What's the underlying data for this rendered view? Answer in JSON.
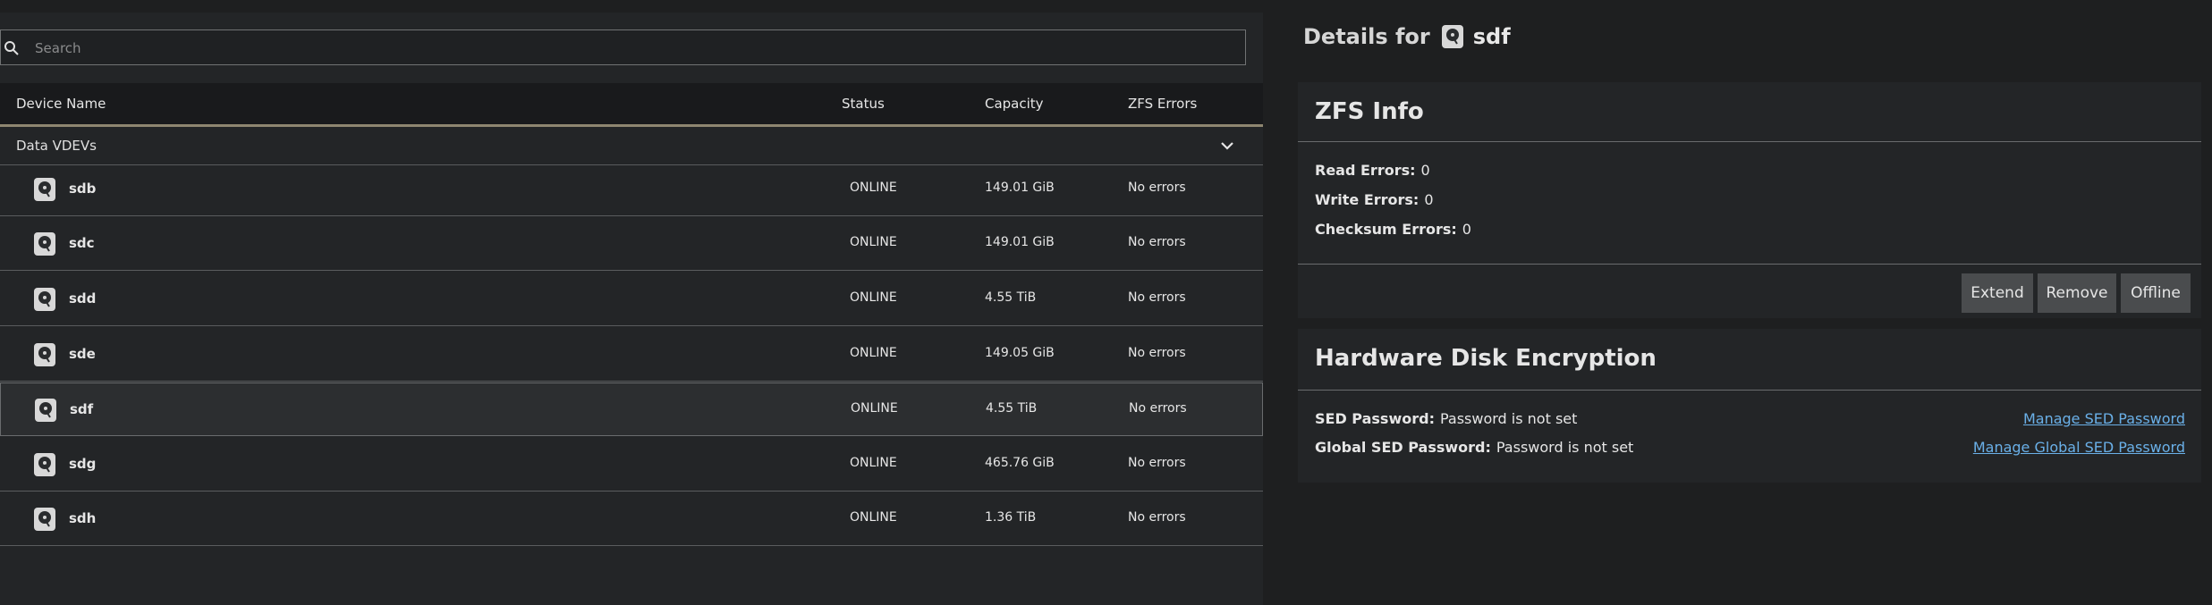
{
  "search": {
    "placeholder": "Search",
    "value": ""
  },
  "table": {
    "headers": {
      "device_name": "Device Name",
      "status": "Status",
      "capacity": "Capacity",
      "zfs_errors": "ZFS Errors"
    },
    "group": "Data VDEVs",
    "rows": [
      {
        "name": "sdb",
        "status": "ONLINE",
        "capacity": "149.01 GiB",
        "errors": "No errors"
      },
      {
        "name": "sdc",
        "status": "ONLINE",
        "capacity": "149.01 GiB",
        "errors": "No errors"
      },
      {
        "name": "sdd",
        "status": "ONLINE",
        "capacity": "4.55 TiB",
        "errors": "No errors"
      },
      {
        "name": "sde",
        "status": "ONLINE",
        "capacity": "149.05 GiB",
        "errors": "No errors"
      },
      {
        "name": "sdf",
        "status": "ONLINE",
        "capacity": "4.55 TiB",
        "errors": "No errors"
      },
      {
        "name": "sdg",
        "status": "ONLINE",
        "capacity": "465.76 GiB",
        "errors": "No errors"
      },
      {
        "name": "sdh",
        "status": "ONLINE",
        "capacity": "1.36 TiB",
        "errors": "No errors"
      }
    ],
    "selected_row": "sdf"
  },
  "details": {
    "prefix": "Details for",
    "device": "sdf",
    "zfs_info": {
      "title": "ZFS Info",
      "read_errors_label": "Read Errors:",
      "read_errors": "0",
      "write_errors_label": "Write Errors:",
      "write_errors": "0",
      "checksum_errors_label": "Checksum Errors:",
      "checksum_errors": "0",
      "buttons": {
        "extend": "Extend",
        "remove": "Remove",
        "offline": "Offline"
      }
    },
    "encryption": {
      "title": "Hardware Disk Encryption",
      "sed_password_label": "SED Password:",
      "sed_password_value": "Password is not set",
      "global_sed_password_label": "Global SED Password:",
      "global_sed_password_value": "Password is not set",
      "manage_sed_link": "Manage SED Password",
      "manage_global_sed_link": "Manage Global SED Password"
    }
  },
  "icons": {
    "search": "search-icon",
    "disk": "hard-disk-icon",
    "chevron": "chevron-down-icon"
  },
  "colors": {
    "accent_border": "#8e8670",
    "link": "#6ab0e8"
  }
}
